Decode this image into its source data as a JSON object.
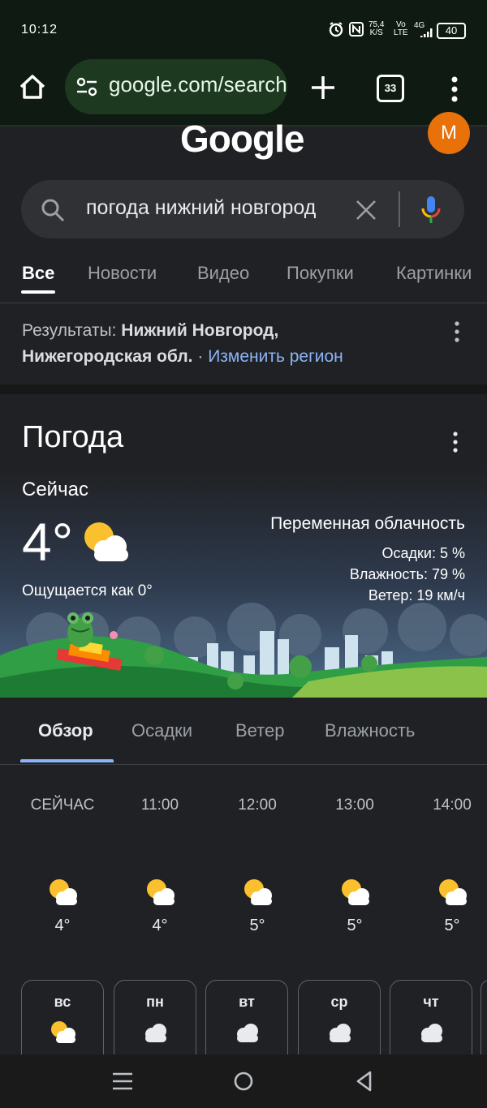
{
  "status": {
    "time": "10:12",
    "net_speed": "75,4",
    "net_speed_unit": "K/S",
    "vo": "Vo",
    "lte": "LTE",
    "signal_type": "4G",
    "battery": "40"
  },
  "browser": {
    "url": "google.com/search",
    "tab_count": "33"
  },
  "google": {
    "logo": "Google",
    "avatar_letter": "M",
    "query": "погода нижний новгород"
  },
  "search_tabs": [
    "Все",
    "Новости",
    "Видео",
    "Покупки",
    "Картинки"
  ],
  "region": {
    "prefix": "Результаты: ",
    "city": "Нижний Новгород,",
    "oblast": "Нижегородская обл.",
    "sep": " · ",
    "change_link": "Изменить регион"
  },
  "weather": {
    "title": "Погода",
    "now_label": "Сейчас",
    "temp": "4°",
    "feels_like": "Ощущается как 0°",
    "condition": "Переменная облачность",
    "precipitation": "Осадки: 5 %",
    "humidity": "Влажность: 79 %",
    "wind": "Ветер: 19 км/ч",
    "tabs": [
      "Обзор",
      "Осадки",
      "Ветер",
      "Влажность"
    ],
    "hourly": [
      {
        "time": "СЕЙЧАС",
        "temp": "4°"
      },
      {
        "time": "11:00",
        "temp": "4°"
      },
      {
        "time": "12:00",
        "temp": "5°"
      },
      {
        "time": "13:00",
        "temp": "5°"
      },
      {
        "time": "14:00",
        "temp": "5°"
      }
    ],
    "days": [
      "вс",
      "пн",
      "вт",
      "ср",
      "чт"
    ]
  },
  "colors": {
    "background": "#202124",
    "browser_bar": "#0f1b12",
    "url_pill": "#1d3a20",
    "accent_link": "#8ab4f8",
    "avatar": "#e8710a"
  }
}
